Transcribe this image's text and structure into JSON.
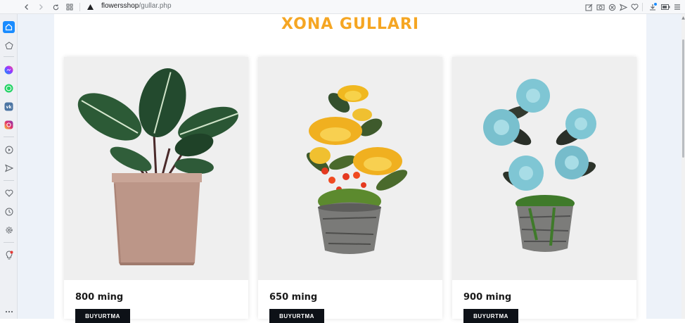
{
  "browser": {
    "url_host": "flowersshop",
    "url_path": "/gullar.php"
  },
  "page": {
    "title": "XONA GULLARI"
  },
  "products": [
    {
      "price": "800 ming",
      "button_label": "BUYURTMA"
    },
    {
      "price": "650 ming",
      "button_label": "BUYURTMA"
    },
    {
      "price": "900 ming",
      "button_label": "BUYURTMA"
    }
  ],
  "colors": {
    "title_accent": "#f5a623",
    "button_bg": "#0d1117",
    "page_background": "#edf2f9",
    "card_image_bg": "#efefef"
  },
  "sidebar": {
    "icons": [
      "home-icon",
      "pentagon-icon",
      "messenger-icon",
      "whatsapp-icon",
      "vk-icon",
      "instagram-icon",
      "play-icon",
      "send-icon",
      "heart-icon",
      "history-icon",
      "settings-icon",
      "tip-icon",
      "more-icon"
    ]
  },
  "toolbar": {
    "icons": [
      "back-icon",
      "forward-icon",
      "reload-icon",
      "tabs-grid-icon",
      "warning-icon",
      "edit-icon",
      "camera-icon",
      "block-icon",
      "share-icon",
      "heart-icon",
      "download-icon",
      "battery-icon",
      "menu-icon"
    ]
  }
}
